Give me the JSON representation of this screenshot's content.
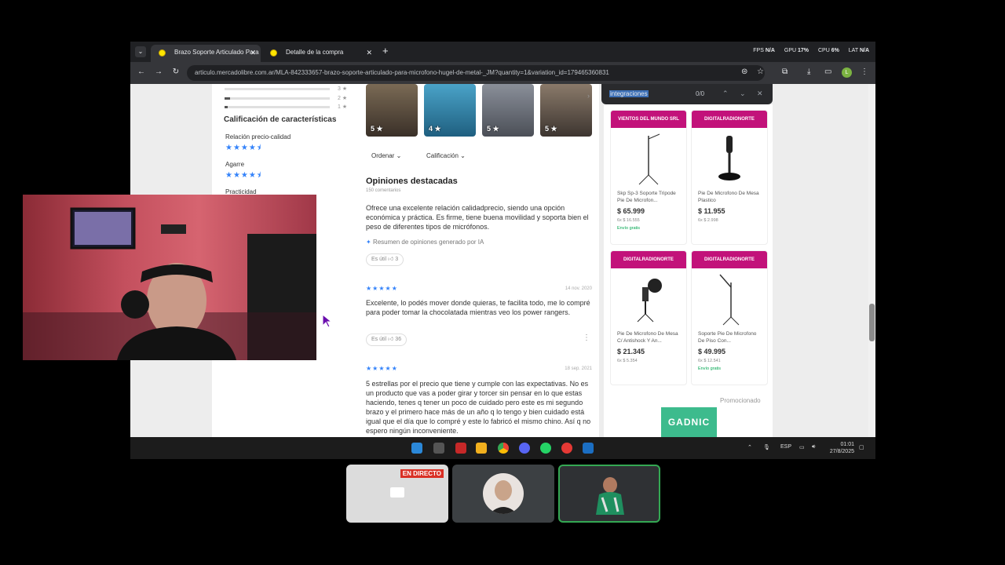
{
  "browser": {
    "tabs": [
      {
        "label": "Brazo Soporte Articulado Para Mi",
        "active": true
      },
      {
        "label": "Detalle de la compra",
        "active": false
      }
    ],
    "new_tab": "+",
    "perf": {
      "fps_label": "FPS",
      "fps_value": "N/A",
      "gpu_label": "GPU",
      "gpu_value": "17%",
      "cpu_label": "CPU",
      "cpu_value": "6%",
      "lat_label": "LAT",
      "lat_value": "N/A"
    },
    "url": "articulo.mercadolibre.com.ar/MLA-842333657-brazo-soporte-articulado-para-microfono-hugel-de-metal-_JM?quantity=1&variation_id=179465360831",
    "profile_initial": "L"
  },
  "find_bar": {
    "query": "integraciones",
    "count": "0/0"
  },
  "ratings": {
    "bars": [
      {
        "label": "3 ★",
        "fraction": 0.0
      },
      {
        "label": "2 ★",
        "fraction": 0.05
      },
      {
        "label": "1 ★",
        "fraction": 0.03
      }
    ],
    "features_title": "Calificación de características",
    "features": [
      {
        "label": "Relación precio-calidad",
        "stars": "★★★★⯨"
      },
      {
        "label": "Agarre",
        "stars": "★★★★⯨"
      },
      {
        "label": "Practicidad",
        "stars": ""
      }
    ]
  },
  "photos": [
    {
      "rating": "5 ★"
    },
    {
      "rating": "4 ★"
    },
    {
      "rating": "5 ★"
    },
    {
      "rating": "5 ★"
    }
  ],
  "filters": {
    "order": "Ordenar",
    "rating": "Calificación"
  },
  "opinions": {
    "title": "Opiniones destacadas",
    "subtitle": "150 comentarios",
    "summary": "Ofrece una excelente relación calidadprecio, siendo una opción económica y práctica. Es firme, tiene buena movilidad y soporta bien el peso de diferentes tipos de micrófonos.",
    "ia_note": "Resumen de opiniones generado por IA",
    "summary_useful": "Es útil",
    "summary_useful_count": "3",
    "reviews": [
      {
        "stars": "★★★★★",
        "date": "14 nov. 2020",
        "text": "Excelente, lo podés mover donde quieras, te facilita todo, me lo compré para poder tomar la chocolatada mientras veo los power rangers.",
        "useful": "Es útil",
        "useful_count": "36"
      },
      {
        "stars": "★★★★★",
        "date": "18 sep. 2021",
        "text": "5 estrellas por el precio que tiene y cumple con las expectativas. No es un producto que vas a poder girar y torcer sin pensar en lo que estas haciendo, tenes q tener un poco de cuidado pero este es mi segundo brazo y el primero hace más de un año q lo tengo y bien cuidado está igual que el día que lo compré y este lo fabricó el mismo chino. Así q no espero ningún inconveniente."
      }
    ]
  },
  "ads": [
    {
      "seller": "VIENTOS DEL MUNDO SRL",
      "name": "Skp Sp-3 Soporte Tripode Pie De Microfon...",
      "price": "$ 65.999",
      "installments": "6x $ 16.555",
      "shipping": "Envío gratis"
    },
    {
      "seller": "DIGITALRADIONORTE",
      "name": "Pie De Microfono De Mesa Plastico",
      "price": "$ 11.955",
      "installments": "6x $ 2.998",
      "shipping": ""
    },
    {
      "seller": "DIGITALRADIONORTE",
      "name": "Pie De Microfono De Mesa C/ Antishock Y An...",
      "price": "$ 21.345",
      "installments": "6x $ 5.354",
      "shipping": ""
    },
    {
      "seller": "DIGITALRADIONORTE",
      "name": "Soporte Pie De Microfono De Piso Con...",
      "price": "$ 49.995",
      "installments": "6x $ 12.541",
      "shipping": "Envío gratis"
    }
  ],
  "promoted": "Promocionado",
  "promo_brand": "GADNIC",
  "taskbar": {
    "lang": "ESP",
    "time": "01:01",
    "date": "27/8/2025"
  },
  "meeting": {
    "live_badge": "EN DIRECTO"
  },
  "colors": {
    "accent": "#3483fa",
    "ad_header": "#c2127a",
    "live": "#d93025"
  }
}
